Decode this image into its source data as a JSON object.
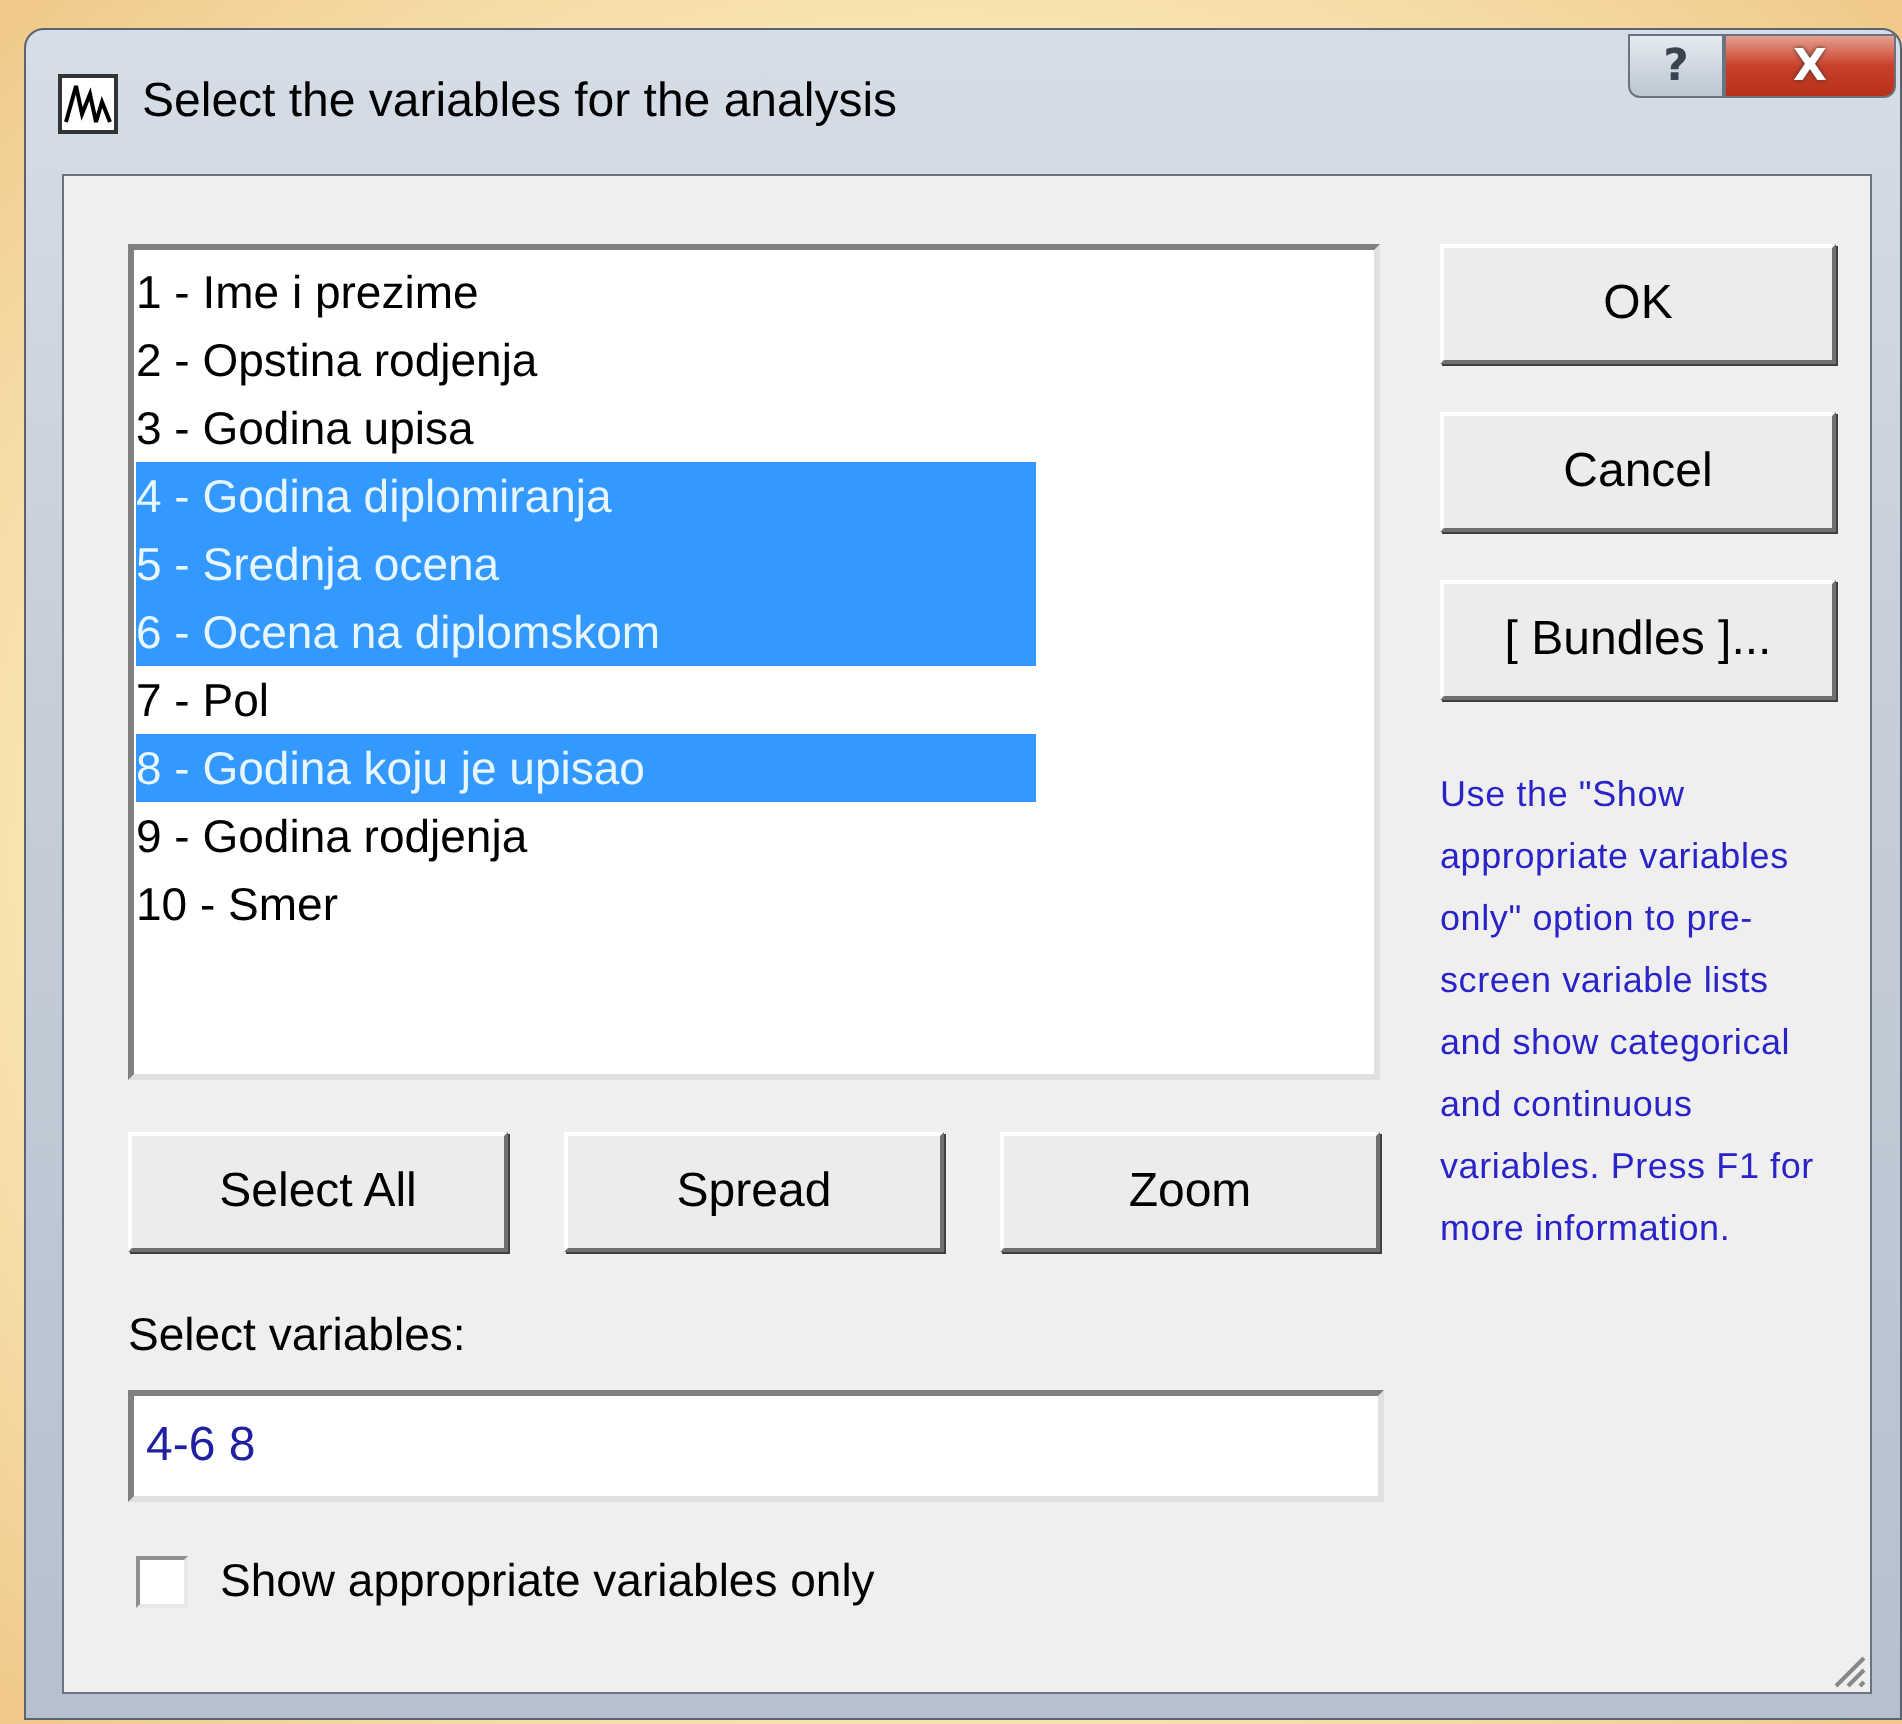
{
  "window": {
    "title": "Select the variables for the analysis",
    "help_button": "?",
    "close_button": "X"
  },
  "variables": [
    {
      "label": "1 - Ime i prezime",
      "selected": false
    },
    {
      "label": "2 - Opstina rodjenja",
      "selected": false
    },
    {
      "label": "3 - Godina upisa",
      "selected": false
    },
    {
      "label": "4 - Godina diplomiranja",
      "selected": true
    },
    {
      "label": "5 - Srednja ocena",
      "selected": true
    },
    {
      "label": "6 - Ocena na diplomskom",
      "selected": true
    },
    {
      "label": "7 - Pol",
      "selected": false
    },
    {
      "label": "8 - Godina koju je upisao",
      "selected": true
    },
    {
      "label": "9 - Godina rodjenja",
      "selected": false
    },
    {
      "label": "10 - Smer",
      "selected": false
    }
  ],
  "list_buttons": [
    "Select All",
    "Spread",
    "Zoom"
  ],
  "side_buttons": [
    "OK",
    "Cancel",
    "[ Bundles ]..."
  ],
  "help_text": "Use the \"Show appropriate variables only\" option to pre-screen variable lists and show categorical and continuous variables. Press F1 for more information.",
  "select_label": "Select variables:",
  "select_value": "4-6 8",
  "show_appropriate": {
    "label": "Show appropriate variables only",
    "checked": false
  }
}
